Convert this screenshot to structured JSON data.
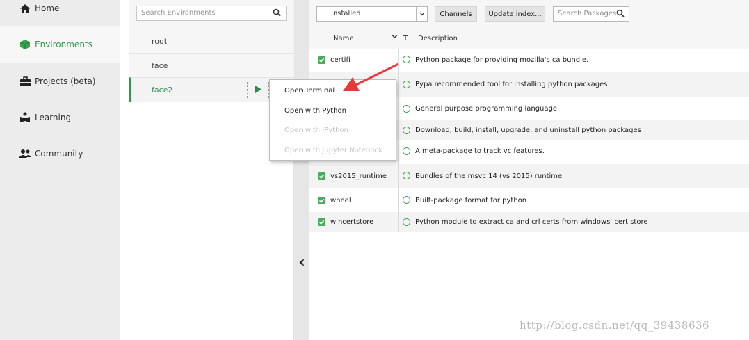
{
  "nav": {
    "items": [
      {
        "label": "Home",
        "icon": "home-icon"
      },
      {
        "label": "Environments",
        "icon": "cube-icon",
        "active": true
      },
      {
        "label": "Projects (beta)",
        "icon": "briefcase-icon"
      },
      {
        "label": "Learning",
        "icon": "book-reader-icon"
      },
      {
        "label": "Community",
        "icon": "people-icon"
      }
    ]
  },
  "environments": {
    "search_placeholder": "Search Environments",
    "items": [
      {
        "name": "root"
      },
      {
        "name": "face"
      },
      {
        "name": "face2",
        "selected": true
      }
    ]
  },
  "packages": {
    "filter_value": "Installed",
    "channels_label": "Channels",
    "update_label": "Update index...",
    "search_placeholder": "Search Packages",
    "columns": {
      "name": "Name",
      "type": "T",
      "description": "Description"
    },
    "rows": [
      {
        "name": "certifi",
        "description": "Python package for providing mozilla's ca bundle."
      },
      {
        "name": "",
        "description": "Pypa recommended tool for installing python packages"
      },
      {
        "name": "",
        "description": "General purpose programming language"
      },
      {
        "name": "",
        "description": "Download, build, install, upgrade, and uninstall python packages"
      },
      {
        "name": "",
        "description": "A meta-package to track vc features."
      },
      {
        "name": "vs2015_runtime",
        "description": "Bundles of the msvc 14 (vs 2015) runtime"
      },
      {
        "name": "wheel",
        "description": "Built-package format for python"
      },
      {
        "name": "wincertstore",
        "description": "Python module to extract ca and crl certs from windows' cert store"
      }
    ]
  },
  "context_menu": {
    "items": [
      {
        "label": "Open Terminal",
        "enabled": true
      },
      {
        "label": "Open with Python",
        "enabled": true
      },
      {
        "label": "Open with IPython",
        "enabled": false
      },
      {
        "label": "Open with Jupyter Notebook",
        "enabled": false
      }
    ]
  },
  "watermark": "http://blog.csdn.net/qq_39438636",
  "colors": {
    "accent": "#2e9a4c",
    "annotation_arrow": "#e8383b"
  }
}
